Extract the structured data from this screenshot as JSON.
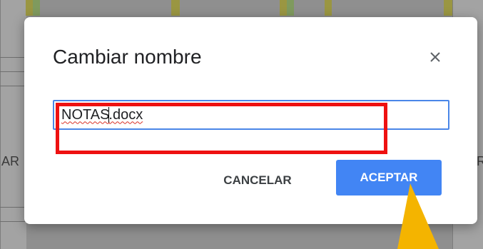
{
  "dialog": {
    "title": "Cambiar nombre",
    "close_icon": "close-icon",
    "input": {
      "value_part1": "NOTAS",
      "value_part2": ".docx"
    },
    "cancel_label": "CANCELAR",
    "accept_label": "ACEPTAR"
  },
  "background": {
    "left_letter": "AR",
    "right_letter": "R"
  },
  "colors": {
    "accent": "#4285f4",
    "highlight": "#ee1111",
    "arrow": "#f4b400",
    "input_border": "#4a86e8"
  }
}
